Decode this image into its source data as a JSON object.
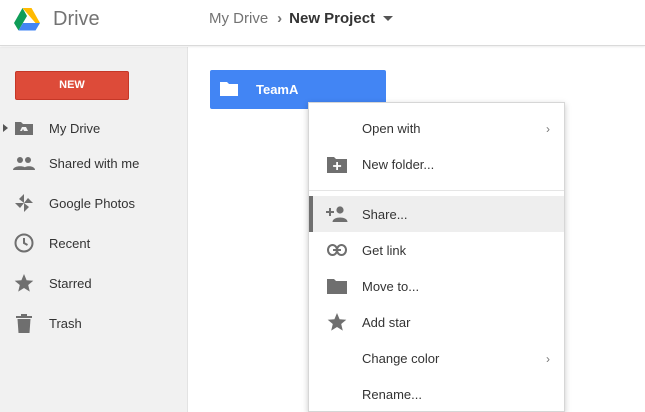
{
  "header": {
    "app_title": "Drive",
    "breadcrumb_root": "My Drive",
    "breadcrumb_separator": "›",
    "breadcrumb_current": "New Project"
  },
  "sidebar": {
    "new_button": "NEW",
    "items": [
      {
        "label": "My Drive",
        "icon": "my-drive-icon"
      },
      {
        "label": "Shared with me",
        "icon": "people-icon"
      },
      {
        "label": "Google Photos",
        "icon": "pinwheel-icon"
      },
      {
        "label": "Recent",
        "icon": "clock-icon"
      },
      {
        "label": "Starred",
        "icon": "star-icon"
      },
      {
        "label": "Trash",
        "icon": "trash-icon"
      }
    ]
  },
  "main": {
    "folder_name": "TeamA"
  },
  "context_menu": {
    "items": [
      {
        "label": "Open with",
        "icon": "",
        "has_submenu": true
      },
      {
        "label": "New folder...",
        "icon": "add-folder-icon"
      },
      {
        "label": "Share...",
        "icon": "add-person-icon",
        "highlighted": true
      },
      {
        "label": "Get link",
        "icon": "link-icon"
      },
      {
        "label": "Move to...",
        "icon": "folder-icon"
      },
      {
        "label": "Add star",
        "icon": "star-icon"
      },
      {
        "label": "Change color",
        "icon": "",
        "has_submenu": true
      },
      {
        "label": "Rename...",
        "icon": ""
      }
    ],
    "submenu_chevron": "›"
  },
  "colors": {
    "new_button": "#dd4b39",
    "folder_tile": "#4285f4",
    "sidebar_bg": "#f1f1f1",
    "menu_highlight": "#eeeeee",
    "icon_gray": "#6f6f6f"
  }
}
